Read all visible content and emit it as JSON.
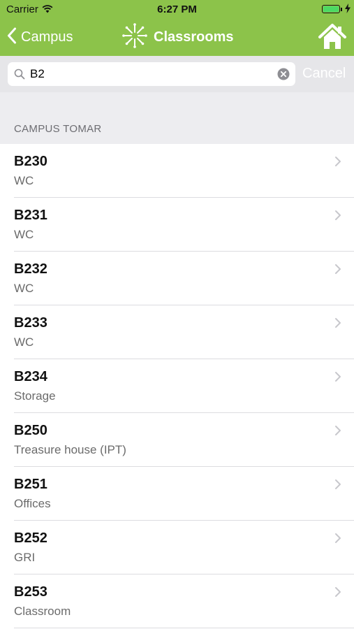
{
  "status_bar": {
    "carrier": "Carrier",
    "time": "6:27 PM"
  },
  "nav": {
    "back_label": "Campus",
    "title": "Classrooms",
    "accent_color": "#8cc34a"
  },
  "search": {
    "value": "B2",
    "cancel_label": "Cancel"
  },
  "section": {
    "header": "CAMPUS TOMAR"
  },
  "rows": [
    {
      "title": "B230",
      "subtitle": "WC"
    },
    {
      "title": "B231",
      "subtitle": "WC"
    },
    {
      "title": "B232",
      "subtitle": "WC"
    },
    {
      "title": "B233",
      "subtitle": "WC"
    },
    {
      "title": "B234",
      "subtitle": "Storage"
    },
    {
      "title": "B250",
      "subtitle": "Treasure house (IPT)"
    },
    {
      "title": "B251",
      "subtitle": "Offices"
    },
    {
      "title": "B252",
      "subtitle": "GRI"
    },
    {
      "title": "B253",
      "subtitle": "Classroom"
    }
  ],
  "icons": {
    "wifi": "wifi-icon",
    "battery": "battery-icon",
    "charging": "charging-bolt-icon",
    "back": "chevron-left-icon",
    "logo": "starburst-logo-icon",
    "home": "home-icon",
    "search": "search-icon",
    "clear": "clear-circle-icon",
    "disclosure": "chevron-right-icon"
  }
}
